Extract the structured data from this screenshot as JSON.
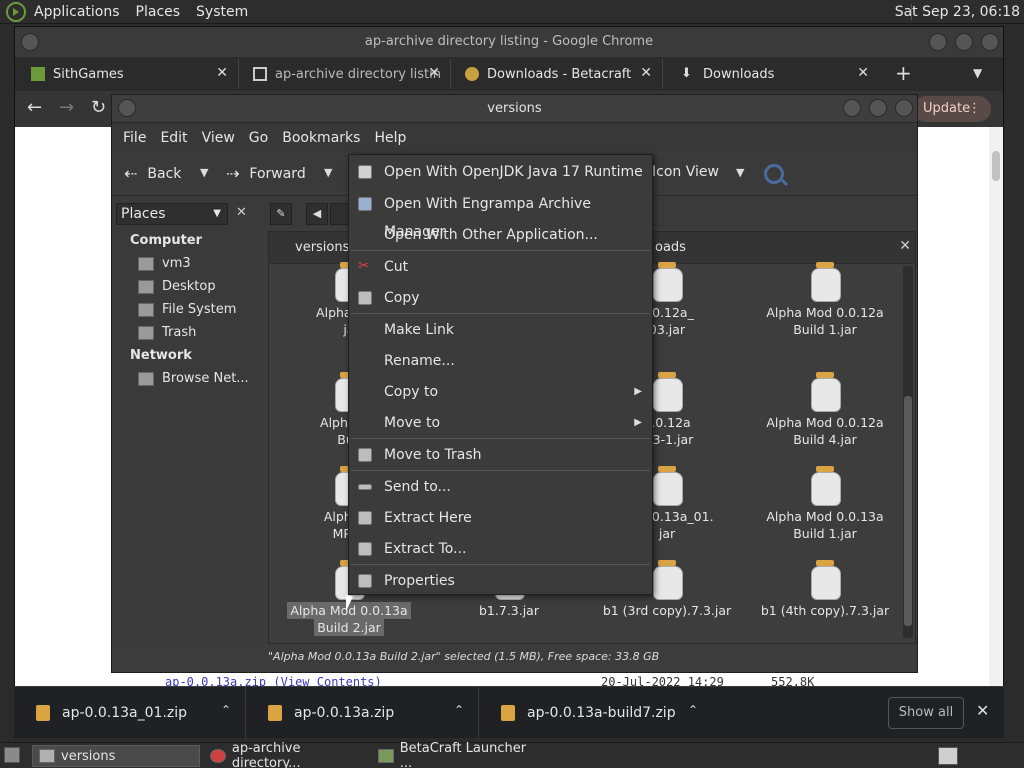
{
  "top_panel": {
    "menus": [
      "Applications",
      "Places",
      "System"
    ],
    "clock": "Sat Sep 23, 06:18"
  },
  "chrome": {
    "title": "ap-archive directory listing - Google Chrome",
    "tabs": [
      {
        "label": "SithGames",
        "icon": "grass-block-icon"
      },
      {
        "label": "ap-archive directory listin",
        "icon": "archive-building-icon"
      },
      {
        "label": "Downloads - Betacraft",
        "icon": "betacraft-icon"
      },
      {
        "label": "Downloads",
        "icon": "download-icon"
      }
    ],
    "update_label": "Update",
    "page_row": {
      "link": "ap-0.0.13a.zip",
      "view": "(View Contents)",
      "date": "20-Jul-2022 14:29",
      "size": "552.8K"
    }
  },
  "file_manager": {
    "title": "versions",
    "menus": [
      "File",
      "Edit",
      "View",
      "Go",
      "Bookmarks",
      "Help"
    ],
    "toolbar": {
      "back": "Back",
      "forward": "Forward",
      "view_mode": "Icon View"
    },
    "places_label": "Places",
    "sidebar": {
      "computer_heading": "Computer",
      "computer_items": [
        "vm3",
        "Desktop",
        "File System",
        "Trash"
      ],
      "network_heading": "Network",
      "network_items": [
        "Browse Net..."
      ]
    },
    "path_tabs": [
      "versions",
      "oads"
    ],
    "files": [
      {
        "l1": "Alpha Mod",
        "l2": "ja"
      },
      {
        "l1": "0.0.12a_",
        "l2": "03.jar"
      },
      {
        "l1": "Alpha Mod 0.0.12a",
        "l2": "Build 1.jar"
      },
      {
        "l1": "Alpha Mo",
        "l2": "Buil"
      },
      {
        "l1": "0.0.12a",
        "l2": "d 3-1.jar"
      },
      {
        "l1": "Alpha Mod 0.0.12a",
        "l2": "Build 4.jar"
      },
      {
        "l1": "Alpha M",
        "l2": "MP-TI"
      },
      {
        "l1": "od 0.0.13a_01.",
        "l2": "jar"
      },
      {
        "l1": "Alpha Mod 0.0.13a",
        "l2": "Build 1.jar"
      },
      {
        "l1": "Alpha Mod 0.0.13a",
        "l2": "Build 2.jar"
      },
      {
        "l1": "b1.7.3.jar",
        "l2": ""
      },
      {
        "l1": "b1 (3rd copy).7.3.jar",
        "l2": ""
      },
      {
        "l1": "b1 (4th copy).7.3.jar",
        "l2": ""
      }
    ],
    "status": "\"Alpha Mod 0.0.13a Build 2.jar\" selected (1.5 MB), Free space: 33.8 GB"
  },
  "context_menu": {
    "items": [
      {
        "label": "Open With OpenJDK Java 17 Runtime",
        "icon": "java-icon"
      },
      {
        "label": "Open With Engrampa Archive Manager",
        "icon": "archive-manager-icon"
      },
      {
        "label": "Open With Other Application...",
        "icon": ""
      },
      {
        "label": "Cut",
        "icon": "scissors-icon"
      },
      {
        "label": "Copy",
        "icon": "copy-icon"
      },
      {
        "label": "Make Link",
        "icon": ""
      },
      {
        "label": "Rename...",
        "icon": ""
      },
      {
        "label": "Copy to",
        "icon": "",
        "submenu": true
      },
      {
        "label": "Move to",
        "icon": "",
        "submenu": true
      },
      {
        "label": "Move to Trash",
        "icon": "trash-icon"
      },
      {
        "label": "Send to...",
        "icon": "send-icon"
      },
      {
        "label": "Extract Here",
        "icon": "extract-icon"
      },
      {
        "label": "Extract To...",
        "icon": "extract-to-icon"
      },
      {
        "label": "Properties",
        "icon": "properties-icon"
      }
    ]
  },
  "downloads": {
    "items": [
      "ap-0.0.13a_01.zip",
      "ap-0.0.13a.zip",
      "ap-0.0.13a-build7.zip"
    ],
    "show_all": "Show all"
  },
  "taskbar": {
    "tasks": [
      "versions",
      "ap-archive directory...",
      "BetaCraft Launcher ..."
    ]
  }
}
